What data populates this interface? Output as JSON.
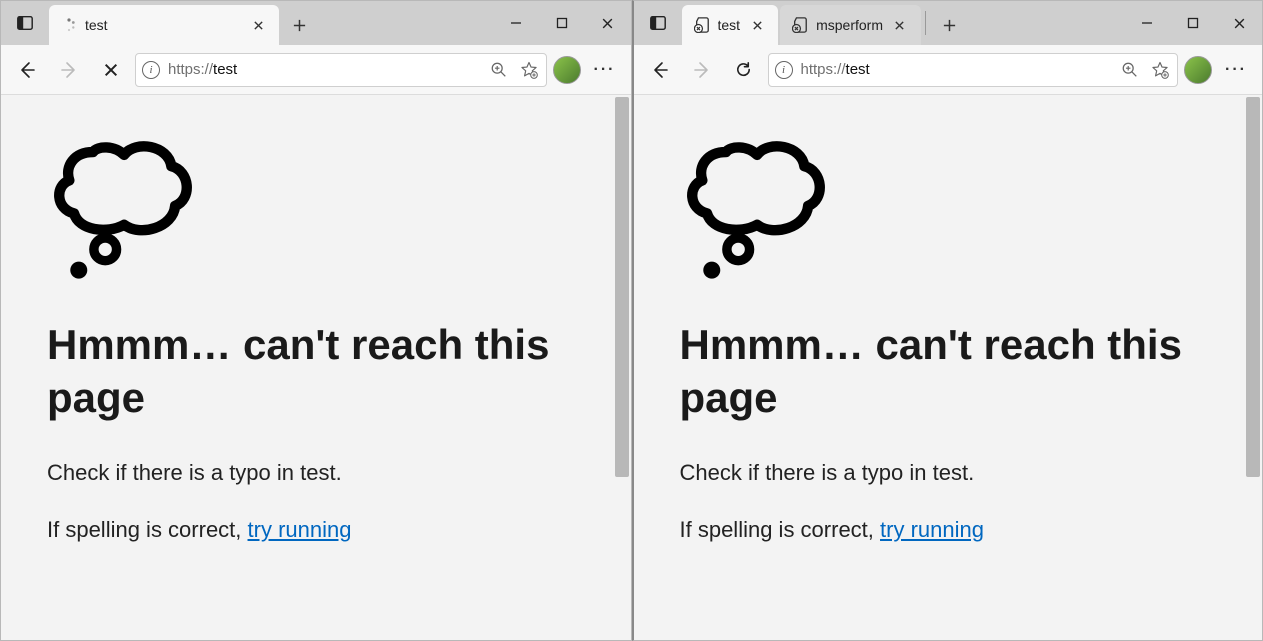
{
  "windows": [
    {
      "tabs": [
        {
          "title": "test",
          "favicon": "loading",
          "active": true
        }
      ],
      "toolbar": {
        "mode": "stop"
      },
      "address": {
        "protocol": "https://",
        "host": "test"
      },
      "error": {
        "title": "Hmmm… can't reach this page",
        "check_line": "Check if there is a typo in test.",
        "spell_prefix": "If spelling is correct, ",
        "spell_link": "try running"
      }
    },
    {
      "tabs": [
        {
          "title": "test",
          "favicon": "error",
          "active": true
        },
        {
          "title": "msperform",
          "favicon": "error",
          "active": false
        }
      ],
      "toolbar": {
        "mode": "refresh"
      },
      "address": {
        "protocol": "https://",
        "host": "test"
      },
      "error": {
        "title": "Hmmm… can't reach this page",
        "check_line": "Check if there is a typo in test.",
        "spell_prefix": "If spelling is correct, ",
        "spell_link": "try running"
      }
    }
  ]
}
